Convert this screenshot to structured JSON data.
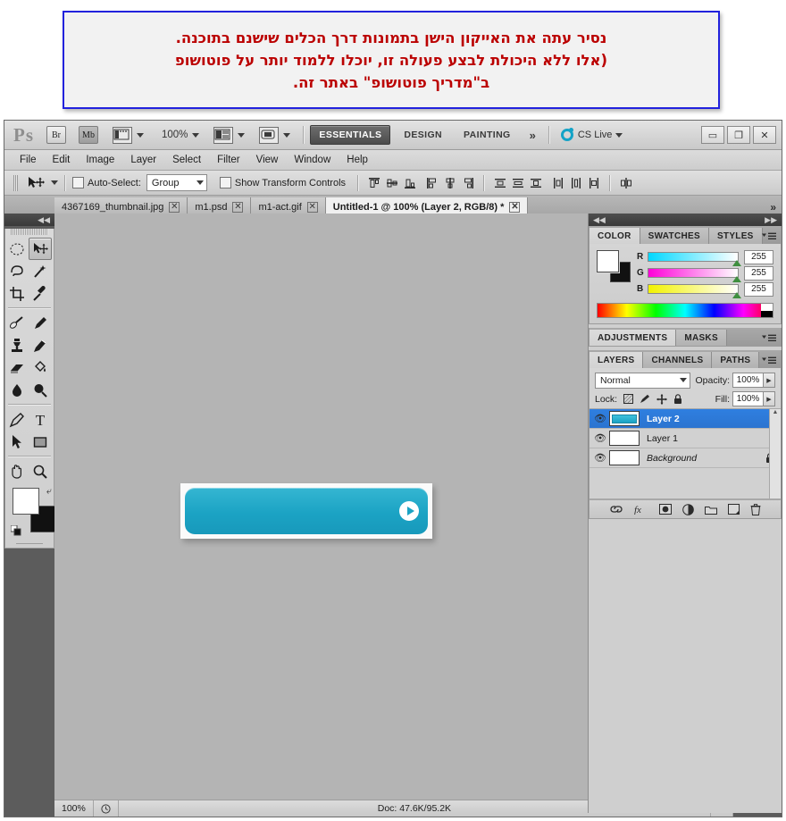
{
  "notice": {
    "lines": [
      "נסיר עתה את האייקון הישן בתמונות דרך הכלים שישנם בתוכנה.",
      "(אלו ללא היכולת לבצע פעולה זו, יוכלו ללמוד יותר על פוטושופ",
      "ב\"מדריך פוטושופ\" באתר זה."
    ],
    "border_color": "#2222dd",
    "text_color": "#bb0000"
  },
  "appbar": {
    "logo": "Ps",
    "bridge_button": "Br",
    "minibridge_button": "Mb",
    "zoom_level": "100%",
    "workspaces": [
      {
        "label": "ESSENTIALS",
        "active": true
      },
      {
        "label": "DESIGN",
        "active": false
      },
      {
        "label": "PAINTING",
        "active": false
      }
    ],
    "more_workspaces": "»",
    "cs_live": "CS Live",
    "window_buttons": [
      "▭",
      "❐",
      "✕"
    ]
  },
  "menubar": {
    "items": [
      "File",
      "Edit",
      "Image",
      "Layer",
      "Select",
      "Filter",
      "View",
      "Window",
      "Help"
    ]
  },
  "optionsbar": {
    "tool": "move-tool",
    "auto_select_label": "Auto-Select:",
    "auto_select_checked": false,
    "auto_select_value": "Group",
    "show_transform_label": "Show Transform Controls",
    "show_transform_checked": false,
    "align_icons": [
      "align-top-edges",
      "align-vertical-centers",
      "align-bottom-edges",
      "align-left-edges",
      "align-horizontal-centers",
      "align-right-edges"
    ],
    "distribute_icons": [
      "distribute-top-edges",
      "distribute-vertical-centers",
      "distribute-bottom-edges",
      "distribute-left-edges",
      "distribute-horizontal-centers",
      "distribute-right-edges"
    ],
    "extra_icon": "auto-align-layers"
  },
  "tabs": {
    "documents": [
      {
        "title": "4367169_thumbnail.jpg",
        "active": false
      },
      {
        "title": "m1.psd",
        "active": false
      },
      {
        "title": "m1-act.gif",
        "active": false
      },
      {
        "title": "Untitled-1 @ 100% (Layer 2, RGB/8) *",
        "active": true
      }
    ],
    "overflow": "»"
  },
  "tools": {
    "collapse": "◀◀",
    "rows": [
      [
        {
          "name": "marquee-tool",
          "selected": false
        },
        {
          "name": "move-tool",
          "selected": true
        }
      ],
      [
        {
          "name": "lasso-tool",
          "selected": false
        },
        {
          "name": "magic-wand-tool",
          "selected": false
        }
      ],
      [
        {
          "name": "crop-tool",
          "selected": false
        },
        {
          "name": "eyedropper-tool",
          "selected": false
        }
      ],
      [
        {
          "name": "healing-brush-tool",
          "selected": false
        },
        {
          "name": "brush-tool",
          "selected": false
        }
      ],
      [
        {
          "name": "clone-stamp-tool",
          "selected": false
        },
        {
          "name": "history-brush-tool",
          "selected": false
        }
      ],
      [
        {
          "name": "eraser-tool",
          "selected": false
        },
        {
          "name": "paint-bucket-tool",
          "selected": false
        }
      ],
      [
        {
          "name": "blur-tool",
          "selected": false
        },
        {
          "name": "dodge-tool",
          "selected": false
        }
      ],
      [
        {
          "name": "pen-tool",
          "selected": false
        },
        {
          "name": "type-tool",
          "selected": false
        }
      ],
      [
        {
          "name": "path-selection-tool",
          "selected": false
        },
        {
          "name": "rectangle-tool",
          "selected": false
        }
      ],
      [
        {
          "name": "hand-tool",
          "selected": false
        },
        {
          "name": "zoom-tool",
          "selected": false
        }
      ]
    ],
    "foreground_color": "#ffffff",
    "background_color": "#111111"
  },
  "minidock": {
    "collapse": "◀◀",
    "items": [
      "mini-bridge-panel",
      "history-panel"
    ]
  },
  "canvas": {
    "background": "#b4b4b4",
    "artwork": {
      "name": "teal-rounded-button",
      "fill_top": "#35b6d2",
      "fill_bottom": "#1899bb",
      "arrow_icon": "circle-arrow-right-icon"
    }
  },
  "statusbar": {
    "zoom": "100%",
    "clock_icon": "clock-icon",
    "doc_info": "Doc: 47.6K/95.2K",
    "play_arrow": "▶"
  },
  "color_panel": {
    "collapse_left": "◀◀",
    "collapse_right": "▶▶",
    "tabs": [
      {
        "label": "COLOR",
        "active": true
      },
      {
        "label": "SWATCHES",
        "active": false
      },
      {
        "label": "STYLES",
        "active": false
      }
    ],
    "menu_icon": "panel-menu-icon",
    "channels": [
      {
        "label": "R",
        "value": "255",
        "track_from": "#00d8ff",
        "track_to": "#ffffff"
      },
      {
        "label": "G",
        "value": "255",
        "track_from": "#ff00d8",
        "track_to": "#ffffff"
      },
      {
        "label": "B",
        "value": "255",
        "track_from": "#f2f200",
        "track_to": "#ffffff"
      }
    ]
  },
  "adjustments_panel": {
    "tabs": [
      {
        "label": "ADJUSTMENTS",
        "active": true
      },
      {
        "label": "MASKS",
        "active": false
      }
    ],
    "menu_icon": "panel-menu-icon"
  },
  "layers_panel": {
    "tabs": [
      {
        "label": "LAYERS",
        "active": true
      },
      {
        "label": "CHANNELS",
        "active": false
      },
      {
        "label": "PATHS",
        "active": false
      }
    ],
    "menu_icon": "panel-menu-icon",
    "blend_mode": "Normal",
    "opacity_label": "Opacity:",
    "opacity_value": "100%",
    "lock_label": "Lock:",
    "lock_icons": [
      "lock-transparent-pixels-icon",
      "lock-image-pixels-icon",
      "lock-position-icon",
      "lock-all-icon"
    ],
    "fill_label": "Fill:",
    "fill_value": "100%",
    "layers": [
      {
        "name": "Layer 2",
        "visible": true,
        "selected": true,
        "italic": false,
        "locked": false,
        "thumb": "teal-button-thumb"
      },
      {
        "name": "Layer 1",
        "visible": true,
        "selected": false,
        "italic": false,
        "locked": false,
        "thumb": "empty-thumb"
      },
      {
        "name": "Background",
        "visible": true,
        "selected": false,
        "italic": true,
        "locked": true,
        "thumb": "empty-thumb"
      }
    ],
    "bottom_icons": [
      "link-layers-icon",
      "layer-style-fx-icon",
      "add-layer-mask-icon",
      "new-adjustment-layer-icon",
      "new-group-icon",
      "new-layer-icon",
      "delete-layer-icon"
    ]
  }
}
